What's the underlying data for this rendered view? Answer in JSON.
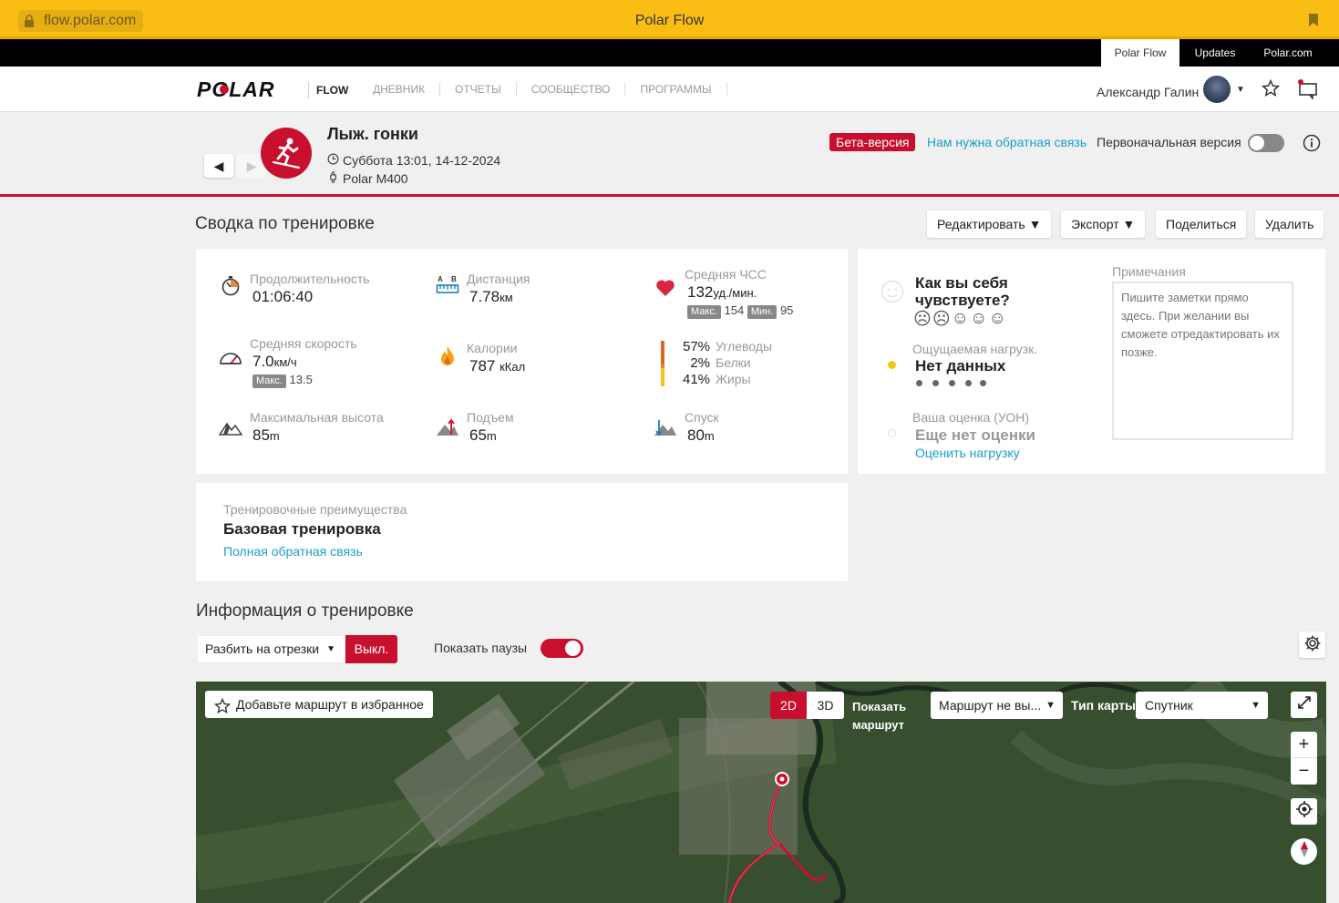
{
  "browser": {
    "url": "flow.polar.com",
    "title": "Polar Flow"
  },
  "top_tabs": [
    "Polar Flow",
    "Updates",
    "Polar.com"
  ],
  "nav": {
    "logo_text": "POLAR",
    "product": "FLOW",
    "links": [
      "ДНЕВНИК",
      "ОТЧЕТЫ",
      "СООБЩЕСТВО",
      "ПРОГРАММЫ"
    ],
    "user_name": "Александр Галин"
  },
  "session": {
    "prev": "◀",
    "next": "▶",
    "title": "Лыж. гонки",
    "datetime": "Суббота 13:01, 14-12-2024",
    "device": "Polar M400",
    "beta_badge": "Бета-версия",
    "feedback_link": "Нам нужна обратная связь",
    "original_version_label": "Первоначальная версия",
    "original_version_on": false
  },
  "summary": {
    "title": "Сводка по тренировке",
    "actions": [
      "Редактировать ▼",
      "Экспорт ▼",
      "Поделиться",
      "Удалить"
    ],
    "duration": {
      "label": "Продолжительность",
      "value": "01:06:40"
    },
    "distance": {
      "label": "Дистанция",
      "value": "7.78",
      "unit": "км"
    },
    "avg_hr": {
      "label": "Средняя ЧСС",
      "value": "132",
      "unit": "уд./мин.",
      "max_label": "Макс.",
      "max": "154",
      "min_label": "Мин.",
      "min": "95"
    },
    "avg_speed": {
      "label": "Средняя скорость",
      "value": "7.0",
      "unit": "км/ч",
      "max_label": "Макс.",
      "max": "13.5"
    },
    "calories": {
      "label": "Калории",
      "value": "787",
      "unit": "кКал"
    },
    "macros": [
      {
        "pct": "57%",
        "name": "Углеводы",
        "color": "#e06a1b"
      },
      {
        "pct": "2%",
        "name": "Белки",
        "color": "#e38b2e"
      },
      {
        "pct": "41%",
        "name": "Жиры",
        "color": "#f5c518"
      }
    ],
    "max_altitude": {
      "label": "Максимальная высота",
      "value": "85",
      "unit": "m"
    },
    "ascent": {
      "label": "Подъем",
      "value": "65",
      "unit": "m"
    },
    "descent": {
      "label": "Спуск",
      "value": "80",
      "unit": "m"
    }
  },
  "feeling": {
    "question": "Как вы себя чувствуете?",
    "faces": [
      "☹",
      "☹",
      "☺",
      "☺",
      "☺"
    ],
    "perceived_label": "Ощущаемая нагрузк.",
    "perceived_value": "Нет данных",
    "rpe_label": "Ваша оценка (УОН)",
    "rpe_value": "Еще нет оценки",
    "rpe_link": "Оценить нагрузку",
    "notes_label": "Примечания",
    "notes_placeholder": "Пишите заметки прямо здесь. При желании вы сможете отредактировать их позже."
  },
  "benefit": {
    "label": "Тренировочные преимущества",
    "value": "Базовая тренировка",
    "link": "Полная обратная связь"
  },
  "info": {
    "title": "Информация о тренировке",
    "split_select": "Разбить на отрезки",
    "split_state": "Выкл.",
    "pauses_label": "Показать паузы",
    "pauses_on": true
  },
  "map": {
    "favorite_label": "Добавьте маршрут в избранное",
    "btn_2d": "2D",
    "btn_3d": "3D",
    "show_route_label": "Показать маршрут",
    "route_select": "Маршрут не вы...",
    "map_type_label": "Тип карты",
    "map_type_value": "Спутник",
    "zoom_in": "+",
    "zoom_out": "−"
  },
  "colors": {
    "brand_red": "#c8102e",
    "link_blue": "#1aa0c8",
    "browser_yellow": "#f9bd14"
  }
}
